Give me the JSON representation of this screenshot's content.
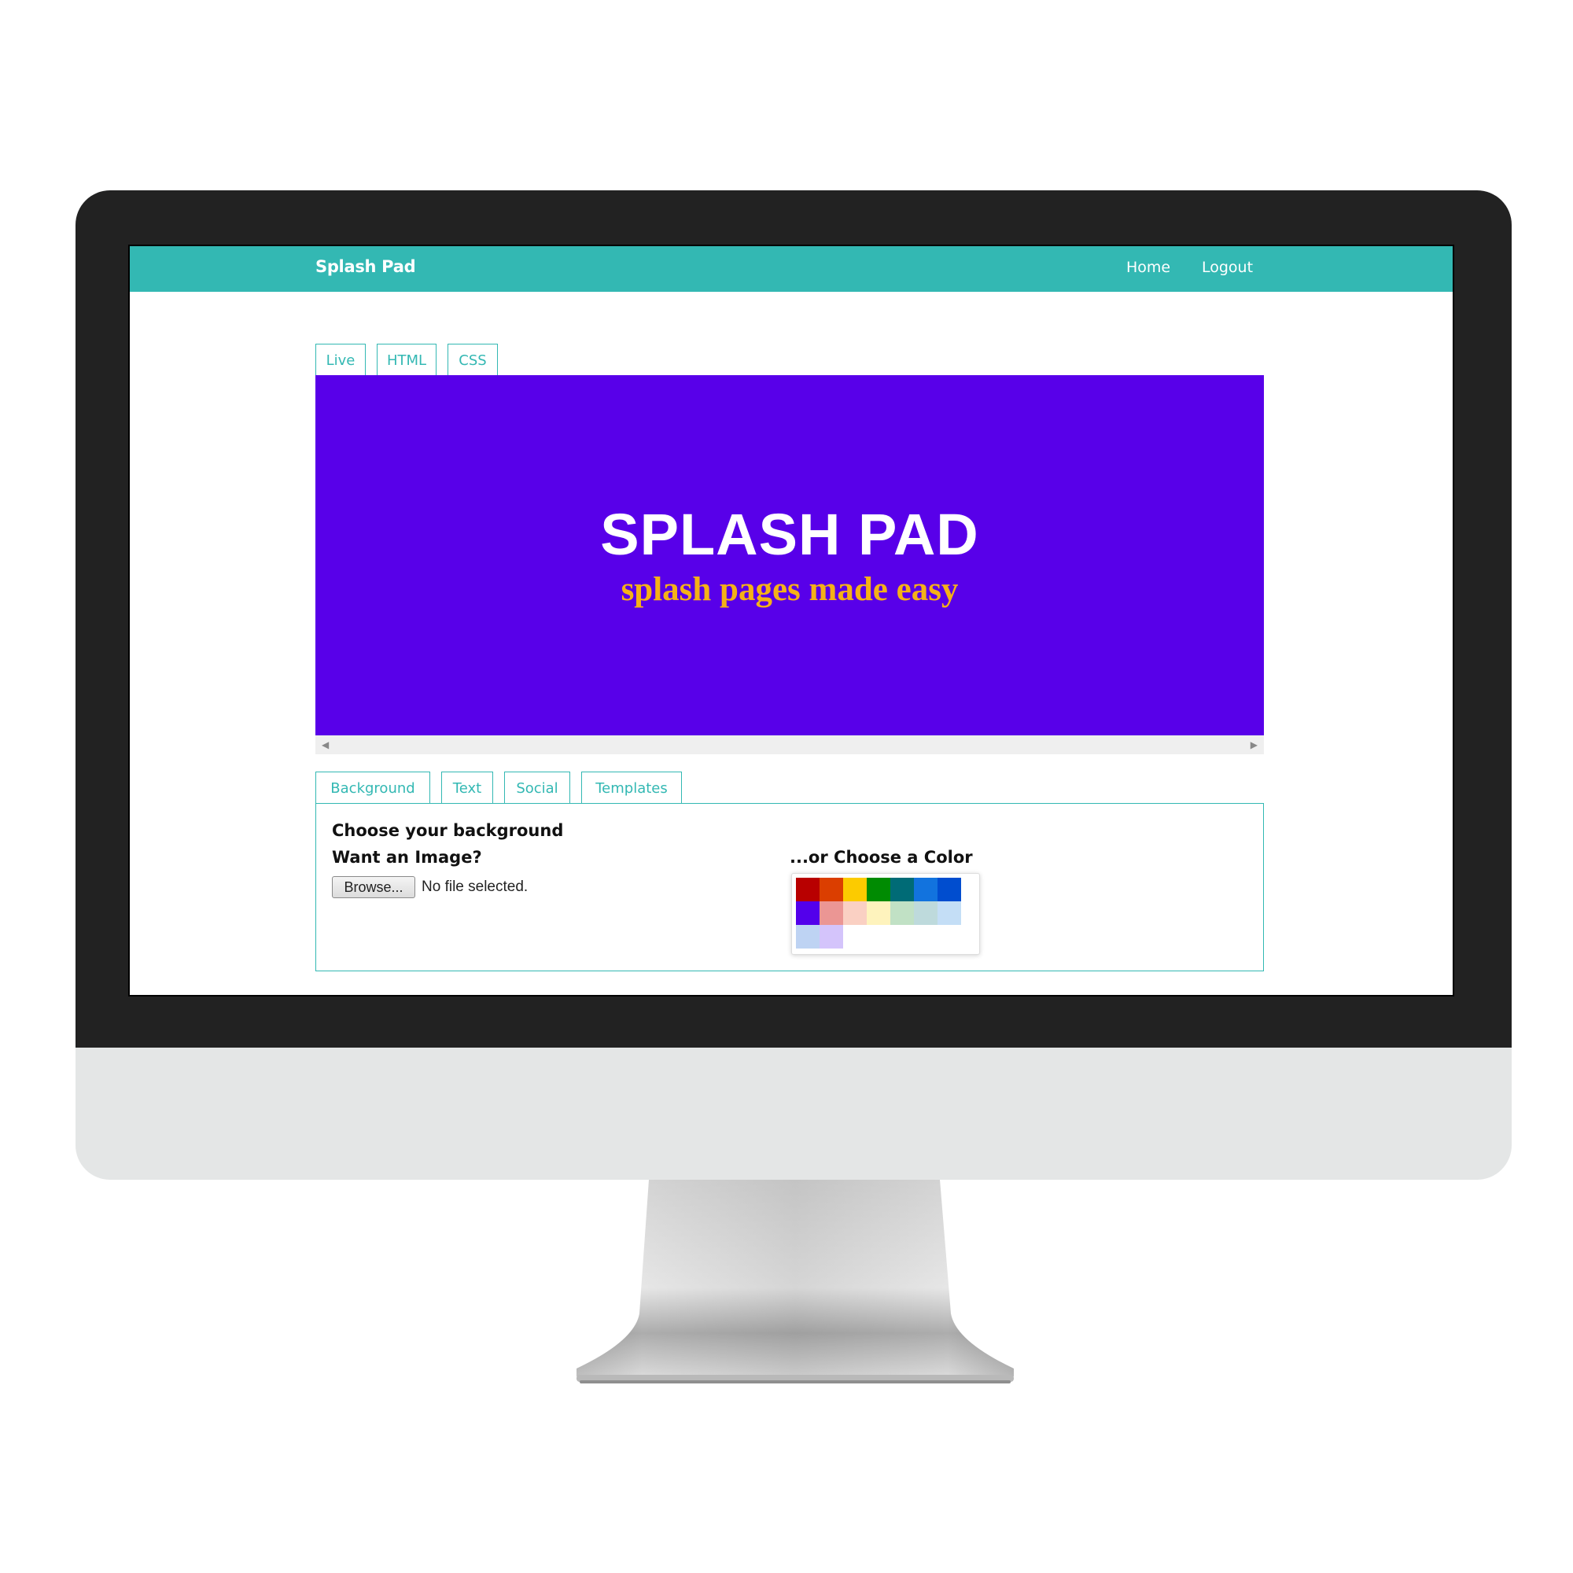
{
  "navbar": {
    "brand": "Splash Pad",
    "links": [
      "Home",
      "Logout"
    ]
  },
  "view_tabs": [
    "Live",
    "HTML",
    "CSS"
  ],
  "preview": {
    "title": "SPLASH PAD",
    "subtitle": "splash pages made easy",
    "background_color": "#5800e9",
    "title_color": "#ffffff",
    "subtitle_color": "#f5b117"
  },
  "editor_tabs": [
    "Background",
    "Text",
    "Social",
    "Templates"
  ],
  "background_panel": {
    "heading": "Choose your background",
    "image_label": "Want an Image?",
    "browse_label": "Browse...",
    "file_status": "No file selected.",
    "color_label": "...or Choose a Color",
    "swatches": [
      "#b80000",
      "#db3e00",
      "#fccb00",
      "#008b02",
      "#006b76",
      "#1273de",
      "#004dcf",
      "#5300eb",
      "#eb9694",
      "#fad0c3",
      "#fef3bd",
      "#c1e1c5",
      "#bedadc",
      "#c4def6",
      "#bed3f3",
      "#d4c4fb"
    ]
  },
  "accent_color": "#33b8b3"
}
